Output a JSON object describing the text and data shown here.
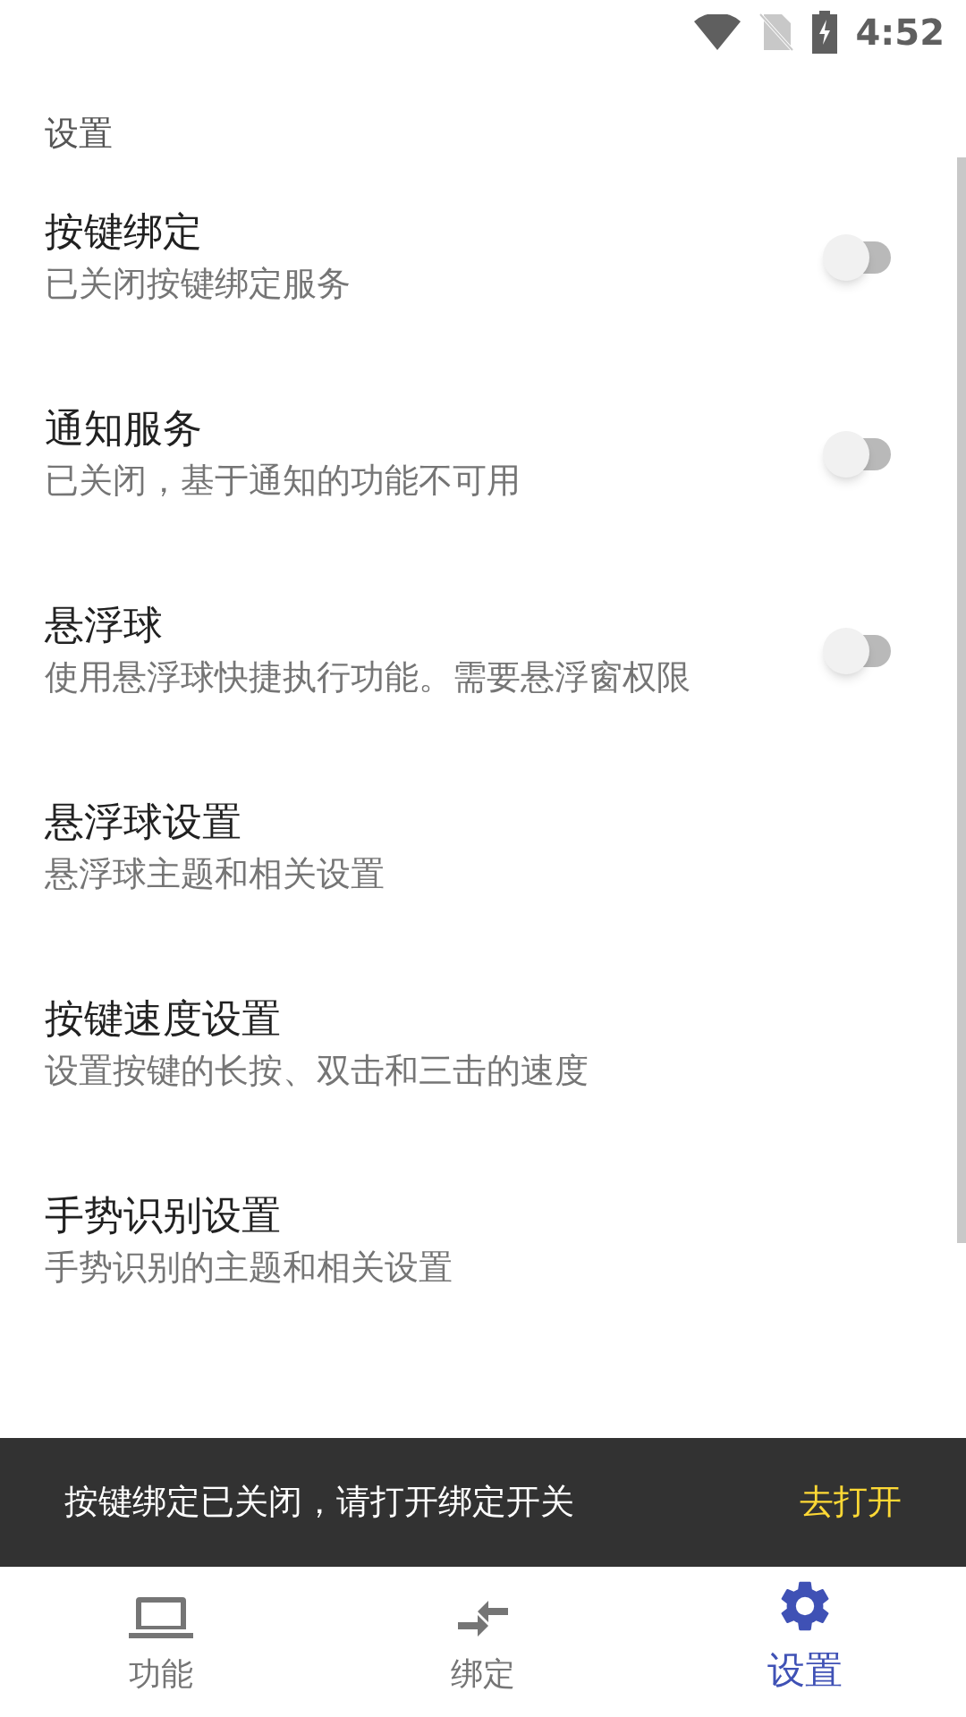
{
  "status_bar": {
    "time": "4:52"
  },
  "section_title": "设置",
  "settings": [
    {
      "kind": "switch",
      "title": "按键绑定",
      "subtitle": "已关闭按键绑定服务",
      "on": false
    },
    {
      "kind": "switch",
      "title": "通知服务",
      "subtitle": "已关闭，基于通知的功能不可用",
      "on": false
    },
    {
      "kind": "switch",
      "title": "悬浮球",
      "subtitle": "使用悬浮球快捷执行功能。需要悬浮窗权限",
      "on": false
    },
    {
      "kind": "link",
      "title": "悬浮球设置",
      "subtitle": "悬浮球主题和相关设置"
    },
    {
      "kind": "link",
      "title": "按键速度设置",
      "subtitle": "设置按键的长按、双击和三击的速度"
    },
    {
      "kind": "link",
      "title": "手势识别设置",
      "subtitle": "手势识别的主题和相关设置"
    }
  ],
  "snackbar": {
    "message": "按键绑定已关闭，请打开绑定开关",
    "action": "去打开"
  },
  "bottom_nav": [
    {
      "kind": "laptop",
      "label": "功能",
      "selected": false
    },
    {
      "kind": "swap",
      "label": "绑定",
      "selected": false
    },
    {
      "kind": "gear",
      "label": "设置",
      "selected": true
    }
  ]
}
